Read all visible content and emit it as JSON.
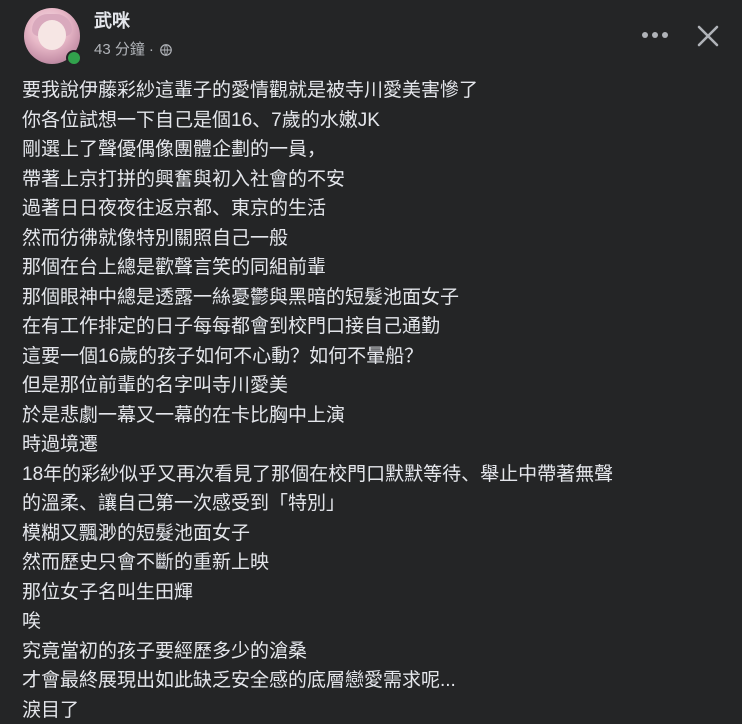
{
  "post": {
    "author": "武咪",
    "time_text": "43 分鐘",
    "separator": "·",
    "privacy_icon": "globe-icon",
    "more_icon": "more-dots-icon",
    "close_icon": "close-icon",
    "lines": [
      "要我說伊藤彩紗這輩子的愛情觀就是被寺川愛美害慘了",
      "你各位試想一下自己是個16、7歲的水嫩JK",
      "剛選上了聲優偶像團體企劃的一員，",
      "帶著上京打拼的興奮與初入社會的不安",
      "過著日日夜夜往返京都、東京的生活",
      "然而彷彿就像特別關照自己一般",
      "那個在台上總是歡聲言笑的同組前輩",
      "那個眼神中總是透露一絲憂鬱與黑暗的短髮池面女子",
      "在有工作排定的日子每每都會到校門口接自己通勤",
      "這要一個16歲的孩子如何不心動？如何不暈船？",
      "但是那位前輩的名字叫寺川愛美",
      "於是悲劇一幕又一幕的在卡比胸中上演",
      "時過境遷",
      "18年的彩紗似乎又再次看見了那個在校門口默默等待、舉止中帶著無聲",
      "的溫柔、讓自己第一次感受到「特別」",
      "模糊又飄渺的短髮池面女子",
      "然而歷史只會不斷的重新上映",
      "那位女子名叫生田輝",
      "唉",
      "究竟當初的孩子要經歷多少的滄桑",
      "才會最終展現出如此缺乏安全感的底層戀愛需求呢...",
      "淚目了"
    ]
  },
  "colors": {
    "background": "#242526",
    "text_primary": "#e4e6eb",
    "text_secondary": "#b0b3b8",
    "online": "#31a24c"
  }
}
